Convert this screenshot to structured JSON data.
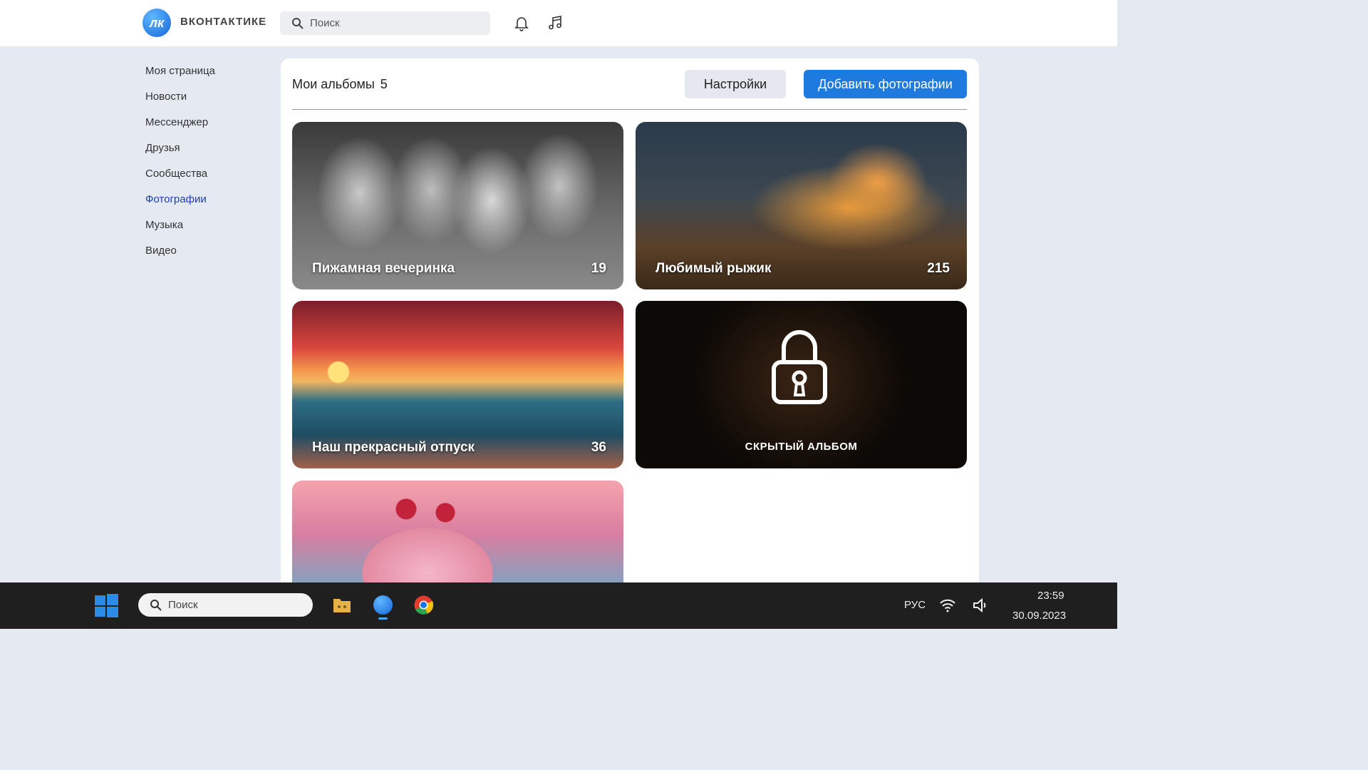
{
  "header": {
    "logo_text": "лк",
    "brand": "ВКОНТАКТИКЕ",
    "search_placeholder": "Поиск"
  },
  "sidebar": {
    "items": [
      {
        "label": "Моя страница"
      },
      {
        "label": "Новости"
      },
      {
        "label": "Мессенджер"
      },
      {
        "label": "Друзья"
      },
      {
        "label": "Сообщества"
      },
      {
        "label": "Фотографии"
      },
      {
        "label": "Музыка"
      },
      {
        "label": "Видео"
      }
    ],
    "active_index": 5
  },
  "albums": {
    "title": "Мои альбомы",
    "count": "5",
    "settings_label": "Настройки",
    "add_label": "Добавить фотографии",
    "items": [
      {
        "name": "Пижамная вечеринка",
        "count": "19"
      },
      {
        "name": "Любимый рыжик",
        "count": "215"
      },
      {
        "name": "Наш прекрасный отпуск",
        "count": "36"
      },
      {
        "name": "СКРЫТЫЙ АЛЬБОМ"
      },
      {
        "name": ""
      }
    ]
  },
  "taskbar": {
    "search_placeholder": "Поиск",
    "language": "РУС",
    "time": "23:59",
    "date": "30.09.2023"
  },
  "colors": {
    "accent": "#1f7ae0",
    "active_nav": "#1e3fb5",
    "page_bg": "#e4e9f2",
    "taskbar_bg": "#1f1f1f"
  },
  "icons": [
    "search-icon",
    "bell-icon",
    "music-icon",
    "windows-start-icon",
    "folder-icon",
    "vk-app-icon",
    "chrome-icon",
    "wifi-icon",
    "volume-icon",
    "lock-icon"
  ]
}
